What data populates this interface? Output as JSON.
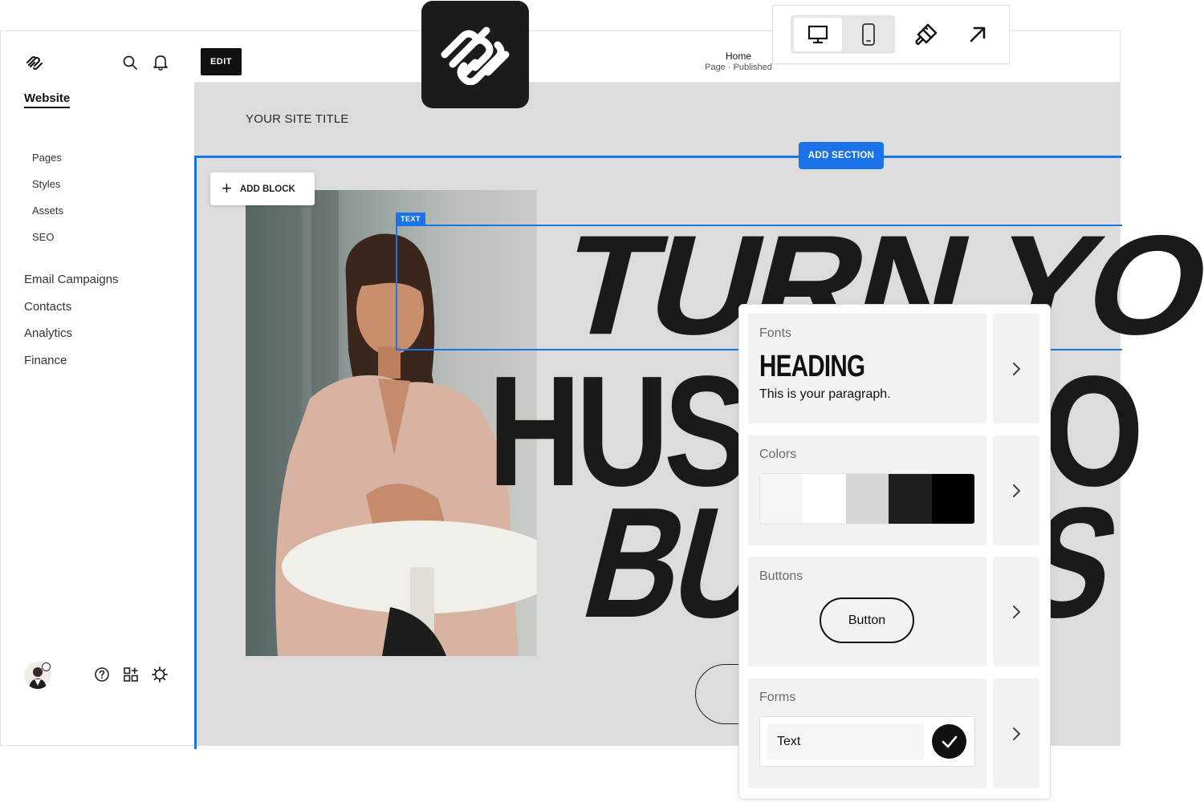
{
  "sidebar": {
    "nav_title": "Website",
    "sub_items": [
      "Pages",
      "Styles",
      "Assets",
      "SEO"
    ],
    "main_items": [
      "Email Campaigns",
      "Contacts",
      "Analytics",
      "Finance"
    ]
  },
  "editor": {
    "edit_label": "EDIT",
    "page_title": "Home",
    "page_status": "Page · Published"
  },
  "canvas": {
    "site_title": "YOUR SITE TITLE",
    "add_section_label": "ADD SECTION",
    "add_block_label": "ADD BLOCK",
    "text_tag": "TEXT",
    "headline_line1": "TURN YOUR",
    "headline_line2": "HUST",
    "headline_line3": "BU",
    "headline_line2_end": "O",
    "headline_line3_end": "S"
  },
  "style_panel": {
    "fonts_label": "Fonts",
    "font_heading": "HEADING",
    "font_paragraph": "This is your paragraph.",
    "colors_label": "Colors",
    "swatch_colors": [
      "#f5f5f5",
      "#ffffff",
      "#d6d6d6",
      "#1e1e1e",
      "#000000"
    ],
    "buttons_label": "Buttons",
    "button_sample": "Button",
    "forms_label": "Forms",
    "form_field_text": "Text"
  },
  "colors": {
    "accent": "#1a73e8",
    "canvas_bg": "#dcdcdc",
    "dark": "#111111"
  }
}
